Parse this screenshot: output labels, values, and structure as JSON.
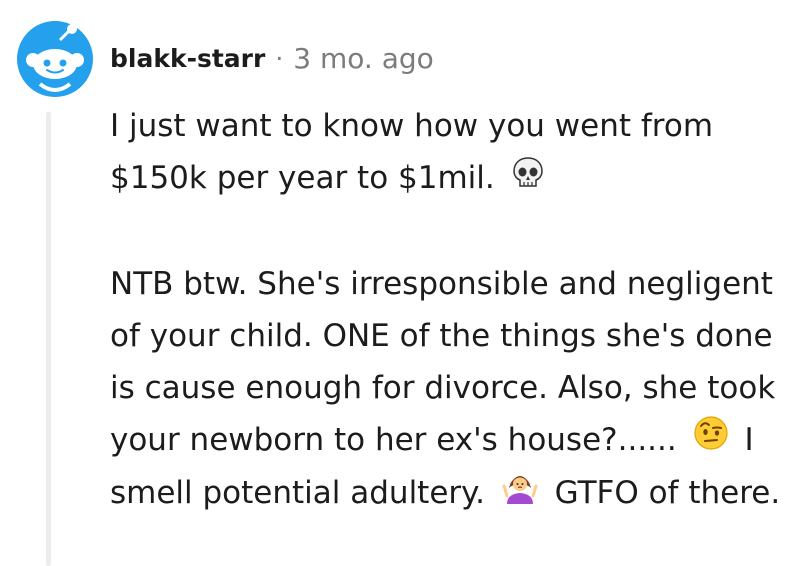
{
  "comment": {
    "author": "blakk-starr",
    "separator": "·",
    "timestamp": "3 mo. ago",
    "avatar_icon": "reddit-snoo-avatar-icon",
    "paragraphs": [
      {
        "text_before": "I just want to know how you went from $150k per year to $1mil.",
        "emoji": "skull-emoji",
        "text_after": ""
      },
      {
        "text_1": "NTB btw. She's irresponsible and negligent of your child. ONE of the things she's done is cause enough for divorce. Also, she took your newborn to her ex's house?......",
        "emoji_1": "face-with-raised-eyebrow-emoji",
        "text_2": "I smell potential adultery.",
        "emoji_2": "person-shrugging-emoji",
        "text_3": "GTFO of there."
      }
    ]
  },
  "colors": {
    "text": "#1c1c1c",
    "meta": "#7c7c7c",
    "thread_line": "#eaedef",
    "avatar_blue": "#24a0ed"
  }
}
